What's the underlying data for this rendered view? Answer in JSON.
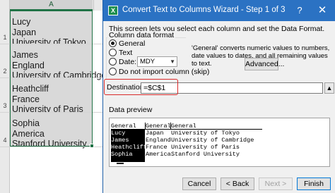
{
  "sheet": {
    "column_header": "A",
    "rows": [
      {
        "num": "1",
        "lines": [
          "Lucy",
          "Japan",
          "University of Tokyo"
        ]
      },
      {
        "num": "2",
        "lines": [
          "James",
          "England",
          "University of Cambridge"
        ]
      },
      {
        "num": "3",
        "lines": [
          "Heathcliff",
          "France",
          "University of Paris"
        ]
      },
      {
        "num": "4",
        "lines": [
          "Sophia",
          "America",
          "Stanford University"
        ]
      }
    ]
  },
  "dialog": {
    "title": "Convert Text to Columns Wizard - Step 1 of 3",
    "help_glyph": "?",
    "close_glyph": "✕",
    "description": "This screen lets you select each column and set the Data Format.",
    "column_format": {
      "label": "Column data format",
      "options": [
        {
          "label": "General",
          "selected": true
        },
        {
          "label": "Text",
          "selected": false
        },
        {
          "label": "Date:",
          "selected": false
        },
        {
          "label": "Do not import column (skip)",
          "selected": false
        }
      ],
      "date_value": "MDY"
    },
    "general_description": "'General' converts numeric values to numbers, date values to dates, and all remaining values to text.",
    "advanced_label": "Advanced...",
    "destination": {
      "label": "Destination:",
      "value": "=$C$1"
    },
    "preview": {
      "label": "Data preview",
      "headers": [
        "General",
        "General",
        "General"
      ],
      "columns": [
        [
          "Lucy",
          "James",
          "Heathcliff",
          "Sophia"
        ],
        [
          "Japan",
          "England",
          "France",
          "America"
        ],
        [
          "University of Tokyo",
          "University of Cambridge",
          "University of Paris",
          "Stanford University"
        ]
      ]
    },
    "buttons": {
      "cancel": "Cancel",
      "back": "< Back",
      "next": "Next >",
      "finish": "Finish"
    }
  },
  "colors": {
    "title_bar": "#2b72c3",
    "excel_green": "#217346",
    "highlight_red": "#d92a2a"
  }
}
